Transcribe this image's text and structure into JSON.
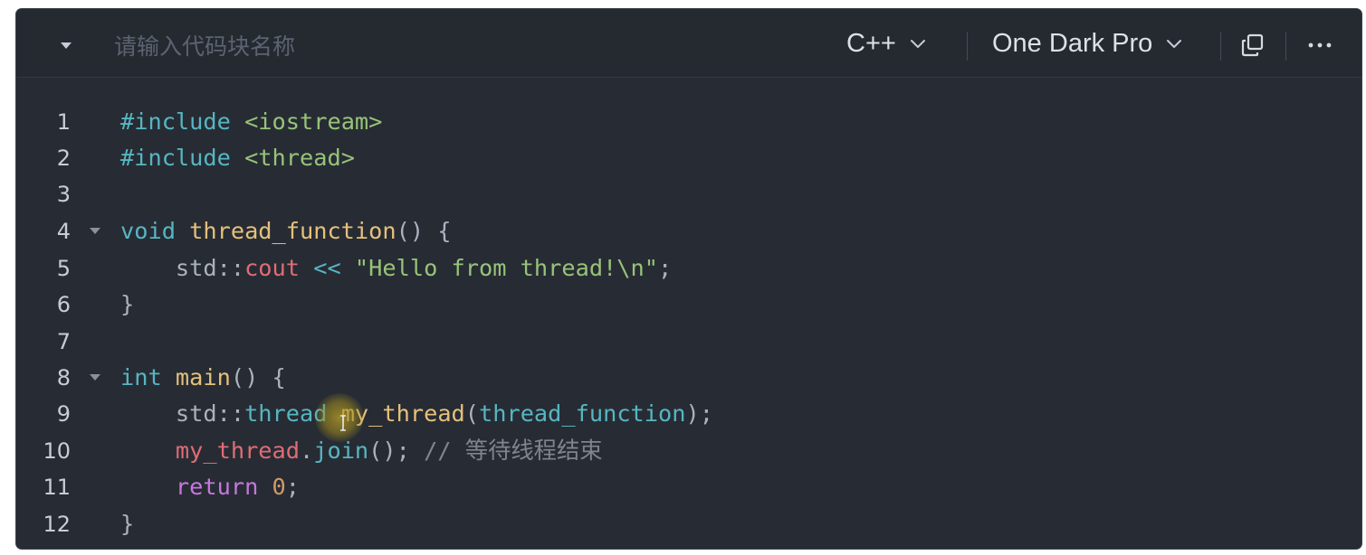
{
  "toolbar": {
    "name_placeholder": "请输入代码块名称",
    "language": "C++",
    "theme": "One Dark Pro",
    "icons": {
      "collapse": "collapse-triangle-icon",
      "language_chevron": "chevron-down-icon",
      "theme_chevron": "chevron-down-icon",
      "copy": "copy-icon",
      "more": "more-horizontal-icon"
    }
  },
  "code": {
    "line_numbers": [
      "1",
      "2",
      "3",
      "4",
      "5",
      "6",
      "7",
      "8",
      "9",
      "10",
      "11",
      "12"
    ],
    "lines": [
      [
        {
          "t": "#include ",
          "c": "pre"
        },
        {
          "t": "<iostream>",
          "c": "inc"
        }
      ],
      [
        {
          "t": "#include ",
          "c": "pre"
        },
        {
          "t": "<thread>",
          "c": "inc"
        }
      ],
      [],
      [
        {
          "t": "void ",
          "c": "kw"
        },
        {
          "t": "thread_function",
          "c": "fn"
        },
        {
          "t": "() {",
          "c": "plain"
        }
      ],
      [
        {
          "t": "    std::",
          "c": "plain"
        },
        {
          "t": "cout",
          "c": "var"
        },
        {
          "t": " << ",
          "c": "op"
        },
        {
          "t": "\"Hello from thread!\\n\"",
          "c": "str"
        },
        {
          "t": ";",
          "c": "plain"
        }
      ],
      [
        {
          "t": "}",
          "c": "plain"
        }
      ],
      [],
      [
        {
          "t": "int ",
          "c": "kw"
        },
        {
          "t": "main",
          "c": "fn"
        },
        {
          "t": "() {",
          "c": "plain"
        }
      ],
      [
        {
          "t": "    std::",
          "c": "plain"
        },
        {
          "t": "thread",
          "c": "type"
        },
        {
          "t": " ",
          "c": "plain"
        },
        {
          "t": "my_thread",
          "c": "fn"
        },
        {
          "t": "(",
          "c": "plain"
        },
        {
          "t": "thread_function",
          "c": "type"
        },
        {
          "t": ");",
          "c": "plain"
        }
      ],
      [
        {
          "t": "    ",
          "c": "plain"
        },
        {
          "t": "my_thread",
          "c": "var"
        },
        {
          "t": ".",
          "c": "plain"
        },
        {
          "t": "join",
          "c": "type"
        },
        {
          "t": "(); ",
          "c": "plain"
        },
        {
          "t": "// 等待线程结束",
          "c": "cm"
        }
      ],
      [
        {
          "t": "    ",
          "c": "plain"
        },
        {
          "t": "return ",
          "c": "kwp"
        },
        {
          "t": "0",
          "c": "num"
        },
        {
          "t": ";",
          "c": "plain"
        }
      ],
      [
        {
          "t": "}",
          "c": "plain"
        }
      ]
    ],
    "foldable_lines": [
      "4",
      "8"
    ]
  },
  "colors": {
    "background": "#272c34",
    "toolbar": "#252a31",
    "keyword": "#56b6c2",
    "function": "#e5c07b",
    "string": "#98c379",
    "variable": "#e06c75",
    "number": "#d19a66",
    "comment": "#7f848e",
    "control": "#c678dd"
  }
}
